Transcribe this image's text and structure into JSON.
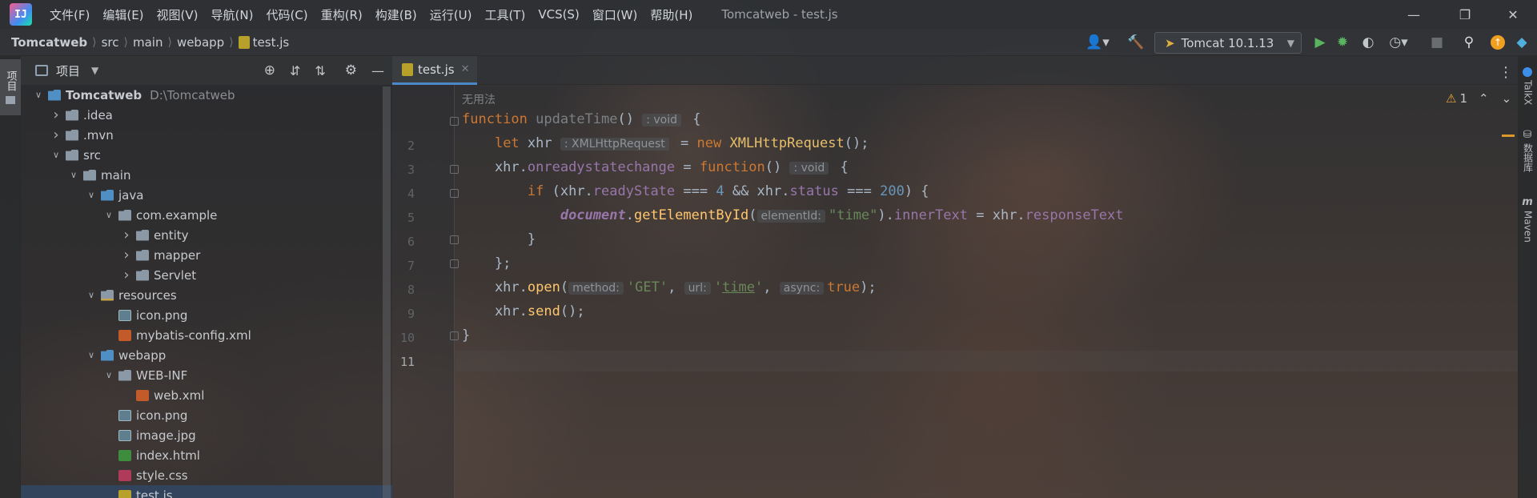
{
  "window": {
    "title": "Tomcatweb - test.js",
    "logo_text": "IJ",
    "minimize_icon": "minimize-icon",
    "maximize_icon": "restore-icon",
    "close_icon": "close-icon"
  },
  "menu": [
    "文件(F)",
    "编辑(E)",
    "视图(V)",
    "导航(N)",
    "代码(C)",
    "重构(R)",
    "构建(B)",
    "运行(U)",
    "工具(T)",
    "VCS(S)",
    "窗口(W)",
    "帮助(H)"
  ],
  "breadcrumb": [
    "Tomcatweb",
    "src",
    "main",
    "webapp",
    "test.js"
  ],
  "toolbar": {
    "run_config": "Tomcat 10.1.13"
  },
  "project_panel": {
    "title": "项目",
    "side_tab": "项目",
    "tree": [
      {
        "label": "Tomcatweb",
        "extra": "D:\\Tomcatweb",
        "depth": 0,
        "arrow": "v",
        "icon": "module"
      },
      {
        "label": ".idea",
        "depth": 1,
        "arrow": ">",
        "icon": "folder"
      },
      {
        "label": ".mvn",
        "depth": 1,
        "arrow": ">",
        "icon": "folder"
      },
      {
        "label": "src",
        "depth": 1,
        "arrow": "v",
        "icon": "folder"
      },
      {
        "label": "main",
        "depth": 2,
        "arrow": "v",
        "icon": "folder"
      },
      {
        "label": "java",
        "depth": 3,
        "arrow": "v",
        "icon": "folder-blue"
      },
      {
        "label": "com.example",
        "depth": 4,
        "arrow": "v",
        "icon": "package"
      },
      {
        "label": "entity",
        "depth": 5,
        "arrow": ">",
        "icon": "package"
      },
      {
        "label": "mapper",
        "depth": 5,
        "arrow": ">",
        "icon": "package"
      },
      {
        "label": "Servlet",
        "depth": 5,
        "arrow": ">",
        "icon": "package"
      },
      {
        "label": "resources",
        "depth": 3,
        "arrow": "v",
        "icon": "folder-res"
      },
      {
        "label": "icon.png",
        "depth": 4,
        "arrow": "",
        "icon": "image"
      },
      {
        "label": "mybatis-config.xml",
        "depth": 4,
        "arrow": "",
        "icon": "xml"
      },
      {
        "label": "webapp",
        "depth": 3,
        "arrow": "v",
        "icon": "folder-blue"
      },
      {
        "label": "WEB-INF",
        "depth": 4,
        "arrow": "v",
        "icon": "folder"
      },
      {
        "label": "web.xml",
        "depth": 5,
        "arrow": "",
        "icon": "xml"
      },
      {
        "label": "icon.png",
        "depth": 4,
        "arrow": "",
        "icon": "image"
      },
      {
        "label": "image.jpg",
        "depth": 4,
        "arrow": "",
        "icon": "image"
      },
      {
        "label": "index.html",
        "depth": 4,
        "arrow": "",
        "icon": "html"
      },
      {
        "label": "style.css",
        "depth": 4,
        "arrow": "",
        "icon": "css"
      },
      {
        "label": "test.js",
        "depth": 4,
        "arrow": "",
        "icon": "js",
        "selected": true
      }
    ]
  },
  "editor": {
    "tab_label": "test.js",
    "usage_hint": "无用法",
    "warnings": "1",
    "line_numbers": [
      "2",
      "3",
      "4",
      "5",
      "6",
      "7",
      "8",
      "9",
      "10",
      "11"
    ],
    "hints": {
      "void": ": void",
      "xhr_type": ": XMLHttpRequest",
      "element_id": "elementId:",
      "method": "method:",
      "url": "url:",
      "async": "async:"
    }
  },
  "right_tabs": [
    "TalkX",
    "数据库",
    "Maven"
  ],
  "colors": {
    "accent": "#4a88c7",
    "keyword": "#cc7832",
    "function": "#ffc66d",
    "number": "#6897bb",
    "string": "#6a8759",
    "property": "#9876aa"
  }
}
